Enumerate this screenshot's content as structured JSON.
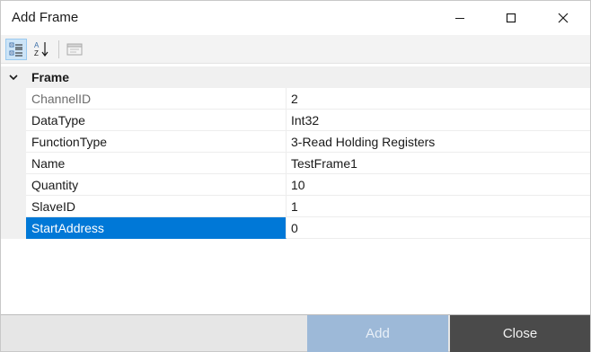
{
  "window": {
    "title": "Add Frame"
  },
  "toolbar": {
    "categorized_icon": "categorized-view-icon",
    "alphabetical_icon": "sort-alphabetical-icon",
    "property_pages_icon": "property-pages-icon"
  },
  "grid": {
    "category": "Frame",
    "properties": [
      {
        "name": "ChannelID",
        "value": "2"
      },
      {
        "name": "DataType",
        "value": "Int32"
      },
      {
        "name": "FunctionType",
        "value": "3-Read Holding Registers"
      },
      {
        "name": "Name",
        "value": "TestFrame1"
      },
      {
        "name": "Quantity",
        "value": "10"
      },
      {
        "name": "SlaveID",
        "value": "1"
      },
      {
        "name": "StartAddress",
        "value": "0"
      }
    ]
  },
  "footer": {
    "add_label": "Add",
    "close_label": "Close"
  },
  "colors": {
    "selection": "#0078d7",
    "add_button": "#9db9d8",
    "close_button": "#4a4a4a"
  }
}
